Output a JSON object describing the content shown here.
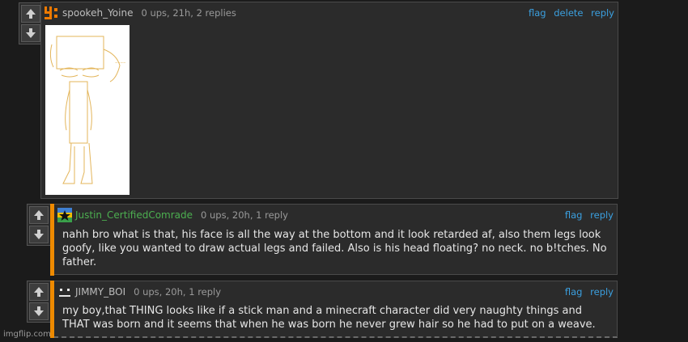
{
  "comments": [
    {
      "username": "spookeh_Yoine",
      "meta": "0 ups, 21h, 2 replies",
      "actions": [
        "flag",
        "delete",
        "reply"
      ],
      "has_image": true
    },
    {
      "username": "Justin_CertifiedComrade",
      "meta": "0 ups, 20h, 1 reply",
      "actions": [
        "flag",
        "reply"
      ],
      "text": "nahh bro what is that, his face is all the way at the bottom and it look retarded af, also them legs look goofy, like you wanted to draw actual legs and failed. Also is his head floating? no neck. no b!tches. No father."
    },
    {
      "username": "JIMMY_BOI",
      "meta": "0 ups, 20h, 1 reply",
      "actions": [
        "flag",
        "reply"
      ],
      "text": "my boy,that THING looks like if a stick man and a minecraft character did very naughty things and THAT was born and it seems that when he was born he never grew hair so he had to put on a weave."
    }
  ],
  "colors": {
    "link": "#3ba0e0",
    "accent": "#ee8a00",
    "green_name": "#4caf50"
  },
  "watermark": "imgflip.com"
}
